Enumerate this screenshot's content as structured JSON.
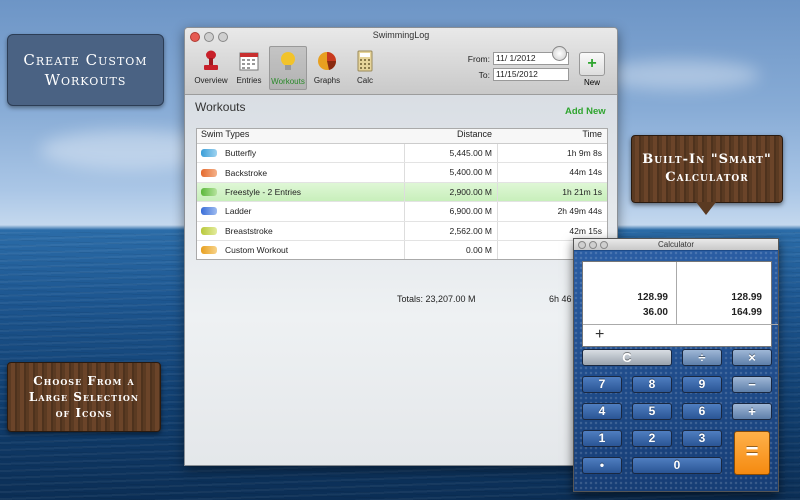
{
  "callouts": {
    "custom_line1": "Create Custom",
    "custom_line2": "Workouts",
    "calc_line1": "Built-In \"Smart\"",
    "calc_line2": "Calculator",
    "icons_line1": "Choose From a",
    "icons_line2": "Large Selection",
    "icons_line3": "of Icons"
  },
  "window": {
    "title": "SwimmingLog",
    "toolbar": [
      {
        "label": "Overview",
        "icon": "stamp-icon"
      },
      {
        "label": "Entries",
        "icon": "calendar-icon"
      },
      {
        "label": "Workouts",
        "icon": "lightbulb-icon",
        "selected": true
      },
      {
        "label": "Graphs",
        "icon": "pie-chart-icon"
      },
      {
        "label": "Calc",
        "icon": "calculator-icon"
      }
    ],
    "from_label": "From:",
    "from_value": "11/ 1/2012",
    "to_label": "To:",
    "to_value": "11/15/2012",
    "new_label": "New"
  },
  "workouts": {
    "section_title": "Workouts",
    "add_new": "Add New",
    "headers": {
      "type": "Swim Types",
      "distance": "Distance",
      "time": "Time"
    },
    "rows": [
      {
        "name": "Butterfly",
        "distance": "5,445.00 M",
        "time": "1h 9m 8s",
        "color": "#3a9ed8"
      },
      {
        "name": "Backstroke",
        "distance": "5,400.00 M",
        "time": "44m 14s",
        "color": "#e46a2e"
      },
      {
        "name": "Freestyle - 2 Entries",
        "distance": "2,900.00 M",
        "time": "1h 21m 1s",
        "color": "#5bb83a",
        "selected": true
      },
      {
        "name": "Ladder",
        "distance": "6,900.00 M",
        "time": "2h 49m 44s",
        "color": "#3a6ed8"
      },
      {
        "name": "Breaststroke",
        "distance": "2,562.00 M",
        "time": "42m 15s",
        "color": "#b8c83a"
      },
      {
        "name": "Custom Workout",
        "distance": "0.00 M",
        "time": "",
        "color": "#e8a020"
      }
    ],
    "totals": "Totals: 23,207.00 M",
    "totals_time": "6h 46"
  },
  "calculator": {
    "title": "Calculator",
    "tape_left": [
      "128.99",
      "36.00"
    ],
    "tape_right": [
      "128.99",
      "164.99"
    ],
    "operator": "+",
    "keys": {
      "clear": "C",
      "divide": "÷",
      "multiply": "×",
      "minus": "−",
      "plus": "+",
      "equals": "=",
      "dot": "•",
      "zero": "0",
      "k1": "1",
      "k2": "2",
      "k3": "3",
      "k4": "4",
      "k5": "5",
      "k6": "6",
      "k7": "7",
      "k8": "8",
      "k9": "9"
    }
  }
}
